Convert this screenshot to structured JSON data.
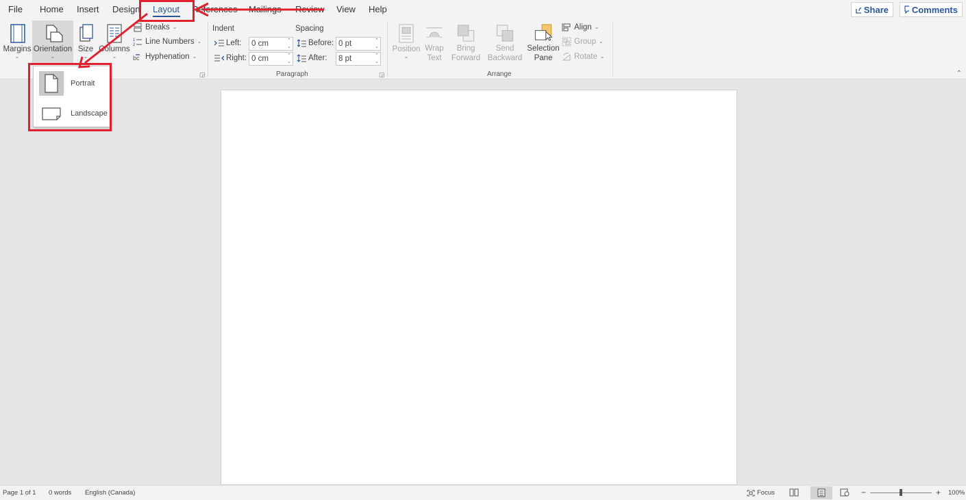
{
  "menu": {
    "tabs": [
      "File",
      "Home",
      "Insert",
      "Design",
      "Layout",
      "References",
      "Mailings",
      "Review",
      "View",
      "Help"
    ],
    "active_tab": "Layout",
    "share_label": "Share",
    "comments_label": "Comments"
  },
  "ribbon": {
    "page_setup": {
      "margins": "Margins",
      "orientation": "Orientation",
      "size": "Size",
      "columns": "Columns",
      "breaks": "Breaks",
      "line_numbers": "Line Numbers",
      "hyphenation": "Hyphenation"
    },
    "paragraph": {
      "group_label": "Paragraph",
      "indent_header": "Indent",
      "spacing_header": "Spacing",
      "left_label": "Left:",
      "left_value": "0 cm",
      "right_label": "Right:",
      "right_value": "0 cm",
      "before_label": "Before:",
      "before_value": "0 pt",
      "after_label": "After:",
      "after_value": "8 pt"
    },
    "arrange": {
      "group_label": "Arrange",
      "position": "Position",
      "wrap_text_1": "Wrap",
      "wrap_text_2": "Text",
      "bring_forward_1": "Bring",
      "bring_forward_2": "Forward",
      "send_backward_1": "Send",
      "send_backward_2": "Backward",
      "selection_pane_1": "Selection",
      "selection_pane_2": "Pane",
      "align": "Align",
      "group": "Group",
      "rotate": "Rotate"
    }
  },
  "orientation_menu": {
    "portrait": "Portrait",
    "landscape": "Landscape",
    "selected": "Portrait"
  },
  "status": {
    "page": "Page 1 of 1",
    "words": "0 words",
    "language": "English (Canada)",
    "focus": "Focus",
    "zoom": "100%"
  },
  "colors": {
    "accent": "#2b579a",
    "annotation": "#e0202c"
  }
}
